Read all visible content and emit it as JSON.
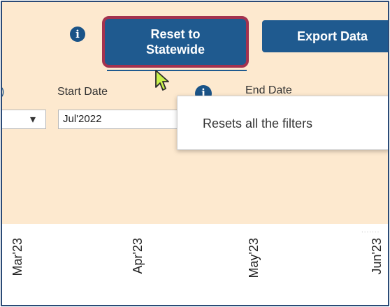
{
  "toolbar": {
    "reset_button_line1": "Reset to",
    "reset_button_line2": "Statewide",
    "export_button": "Export Data",
    "info_icon_glyph": "i"
  },
  "filters": {
    "start_date_label": "Start Date",
    "start_date_value": "Jul'2022",
    "end_date_label": "End Date",
    "left_dropdown_arrow": "▾"
  },
  "tooltip": {
    "text": "Resets all the filters"
  },
  "axis": {
    "labels": [
      "Mar'23",
      "Apr'23",
      "May'23",
      "Jun'23"
    ]
  },
  "colors": {
    "panel_bg": "#fde9cf",
    "button_bg": "#1f5a8f",
    "highlight_border": "#a3324f",
    "frame_border": "#2b4a76"
  }
}
